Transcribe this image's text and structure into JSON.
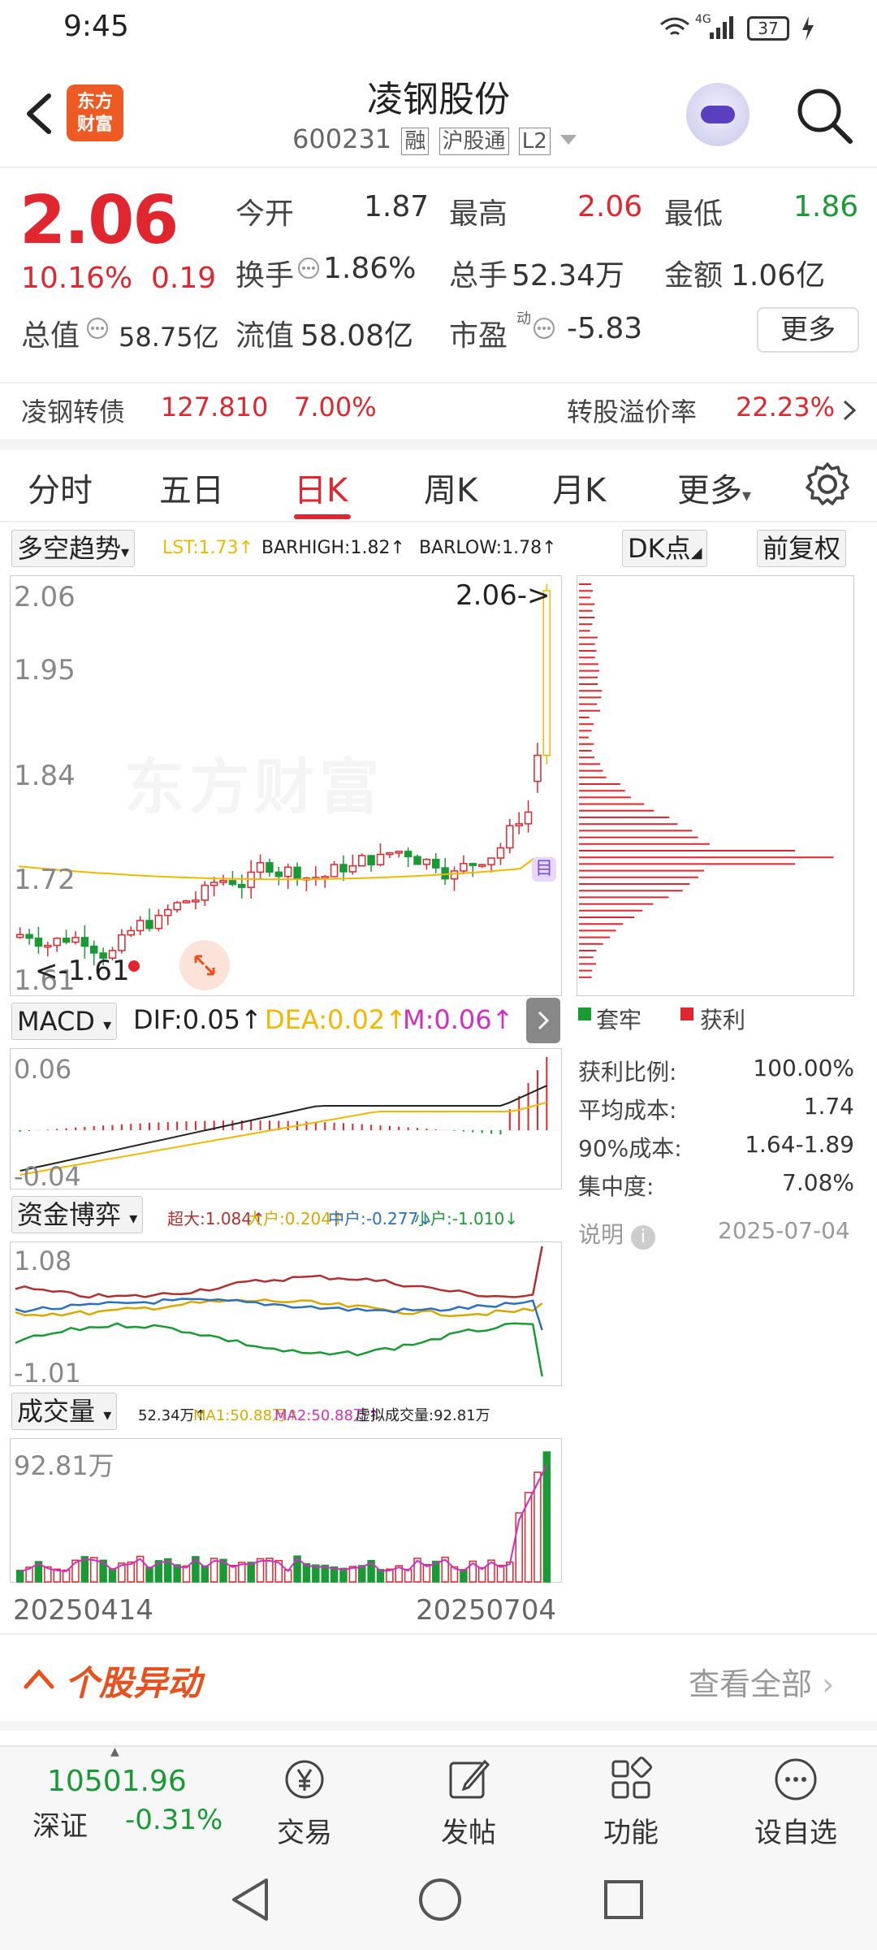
{
  "status_bar": {
    "time": "9:45",
    "network": "4G",
    "battery": "37"
  },
  "header": {
    "logo_text_1": "东方",
    "logo_text_2": "财富",
    "stock_name": "凌钢股份",
    "stock_code": "600231",
    "tags": [
      "融",
      "沪股通",
      "L2"
    ]
  },
  "quote": {
    "price": "2.06",
    "change_pct": "10.16%",
    "change": "0.19",
    "rows": [
      [
        {
          "label": "今开",
          "value": "1.87",
          "color": "dark"
        },
        {
          "label": "最高",
          "value": "2.06",
          "color": "red"
        },
        {
          "label": "最低",
          "value": "1.86",
          "color": "green"
        }
      ],
      [
        {
          "label": "换手",
          "value": "1.86%",
          "color": "dark"
        },
        {
          "label": "总手",
          "value": "52.34万",
          "color": "dark"
        },
        {
          "label": "金额",
          "value": "1.06亿",
          "color": "dark"
        }
      ]
    ],
    "total_mv_label": "总值",
    "total_mv": "58.75亿",
    "float_mv_label": "流值",
    "float_mv": "58.08亿",
    "pe_label": "市盈",
    "pe_sup": "动",
    "pe": "-5.83",
    "more_label": "更多"
  },
  "bond": {
    "name": "凌钢转债",
    "price": "127.810",
    "pct": "7.00%",
    "premium_label": "转股溢价率",
    "premium": "22.23%"
  },
  "tabs": [
    "分时",
    "五日",
    "日K",
    "周K",
    "月K",
    "更多"
  ],
  "active_tab": 2,
  "indicator_bar": {
    "selector": "多空趋势",
    "lst": "LST:1.73↑",
    "barhigh": "BARHIGH:1.82↑",
    "barlow": "BARLOW:1.78↑",
    "dk_label": "DK点",
    "fq_label": "前复权"
  },
  "kline": {
    "y_labels": [
      "2.06",
      "1.95",
      "1.84",
      "1.72",
      "1.61"
    ],
    "current_marker": "2.06->",
    "low_marker": "<-1.61",
    "watermark": "东方财富",
    "ma_marker": "目"
  },
  "macd": {
    "selector": "MACD",
    "dif": "DIF:0.05↑",
    "dea": "DEA:0.02↑",
    "m": "M:0.06↑",
    "y_top": "0.06",
    "y_bottom": "-0.04"
  },
  "capital": {
    "selector": "资金博弈",
    "super": "超大:1.084↑",
    "large": "大户:0.204↑",
    "mid": "中户:-0.277↓",
    "small": "小户:-1.010↓",
    "y_top": "1.08",
    "y_bottom": "-1.01"
  },
  "volume": {
    "selector": "成交量",
    "vol": "52.34万↑",
    "ma1": "MA1:50.88万↑",
    "ma2": "MA2:50.88万↑",
    "virtual": "虚拟成交量:92.81万",
    "y_top": "92.81万",
    "date_start": "20250414",
    "date_end": "20250704"
  },
  "chips": {
    "legend_trapped": "套牢",
    "legend_profit": "获利",
    "stats": [
      {
        "label": "获利比例:",
        "value": "100.00%"
      },
      {
        "label": "平均成本:",
        "value": "1.74"
      },
      {
        "label": "90%成本:",
        "value": "1.64-1.89"
      },
      {
        "label": "集中度:",
        "value": "7.08%"
      }
    ],
    "note_label": "说明",
    "date": "2025-07-04"
  },
  "anomaly": {
    "title": "个股异动",
    "view_all": "查看全部"
  },
  "bottom_bar": {
    "index_value": "10501.96",
    "index_name": "深证",
    "index_pct": "-0.31%",
    "items": [
      "交易",
      "发帖",
      "功能",
      "设自选"
    ]
  },
  "colors": {
    "red": "#e0272f",
    "green": "#1a9a35",
    "gold": "#f0b800",
    "magenta": "#d030c0",
    "blue": "#2a6fc0"
  }
}
